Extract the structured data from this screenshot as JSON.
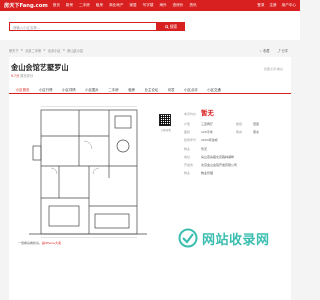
{
  "topnav": {
    "logo": "房天下Fang.com",
    "links": [
      "首页",
      "新房",
      "二手房",
      "租房",
      "商业地产",
      "家居",
      "写字楼",
      "海外",
      "查房价",
      "资讯"
    ],
    "right": [
      "登录",
      "注册",
      "用户中心"
    ]
  },
  "search": {
    "placeholder": "请输入小区名称...",
    "button": "搜索"
  },
  "breadcrumb": [
    "房天下",
    "北京二手房",
    "北京小区",
    "房山区小区"
  ],
  "breadcrumb_right": [
    "收藏",
    "分享"
  ],
  "title": "金山会馆艺墅罗山",
  "score": {
    "value": "9.7",
    "label": "分",
    "note": "暂无评分"
  },
  "topright_link": "我要点评/看房",
  "tabs": [
    {
      "label": "小区首页",
      "active": true
    },
    {
      "label": "小区行情",
      "active": false
    },
    {
      "label": "小区详情",
      "active": false
    },
    {
      "label": "小区图片",
      "active": false
    },
    {
      "label": "二手房",
      "active": false
    },
    {
      "label": "租房",
      "active": false
    },
    {
      "label": "业主论坛",
      "active": false
    },
    {
      "label": "问答",
      "active": false
    },
    {
      "label": "小区点评",
      "active": false
    },
    {
      "label": "小区交通",
      "active": false
    }
  ],
  "info": {
    "price_label": "本月均价",
    "price_value": "暂无",
    "rows": [
      {
        "k": "户型",
        "v": "三室两厅"
      },
      {
        "k": "面积",
        "v": "120平米"
      },
      {
        "k": "建筑年代",
        "v": "2003年建成"
      },
      {
        "k": "物业",
        "v": "暂无"
      },
      {
        "k": "地址",
        "v": "房山燕房路北京森林湖畔"
      },
      {
        "k": "开发商",
        "v": "北京金山会馆开发有限公司"
      },
      {
        "k": "物业",
        "v": "物业管理"
      }
    ],
    "half_left": {
      "k": "楼层",
      "v": "低层"
    },
    "half_right": {
      "k": "朝向",
      "v": "南北"
    }
  },
  "qr_text": "扫码查看",
  "caption": {
    "text": "一键看房看新房，",
    "link": "赢iPhone大奖"
  },
  "watermark": {
    "text": "网站收录网"
  },
  "colors": {
    "brand_red": "#d7201f",
    "watermark": "#19b3a3"
  }
}
